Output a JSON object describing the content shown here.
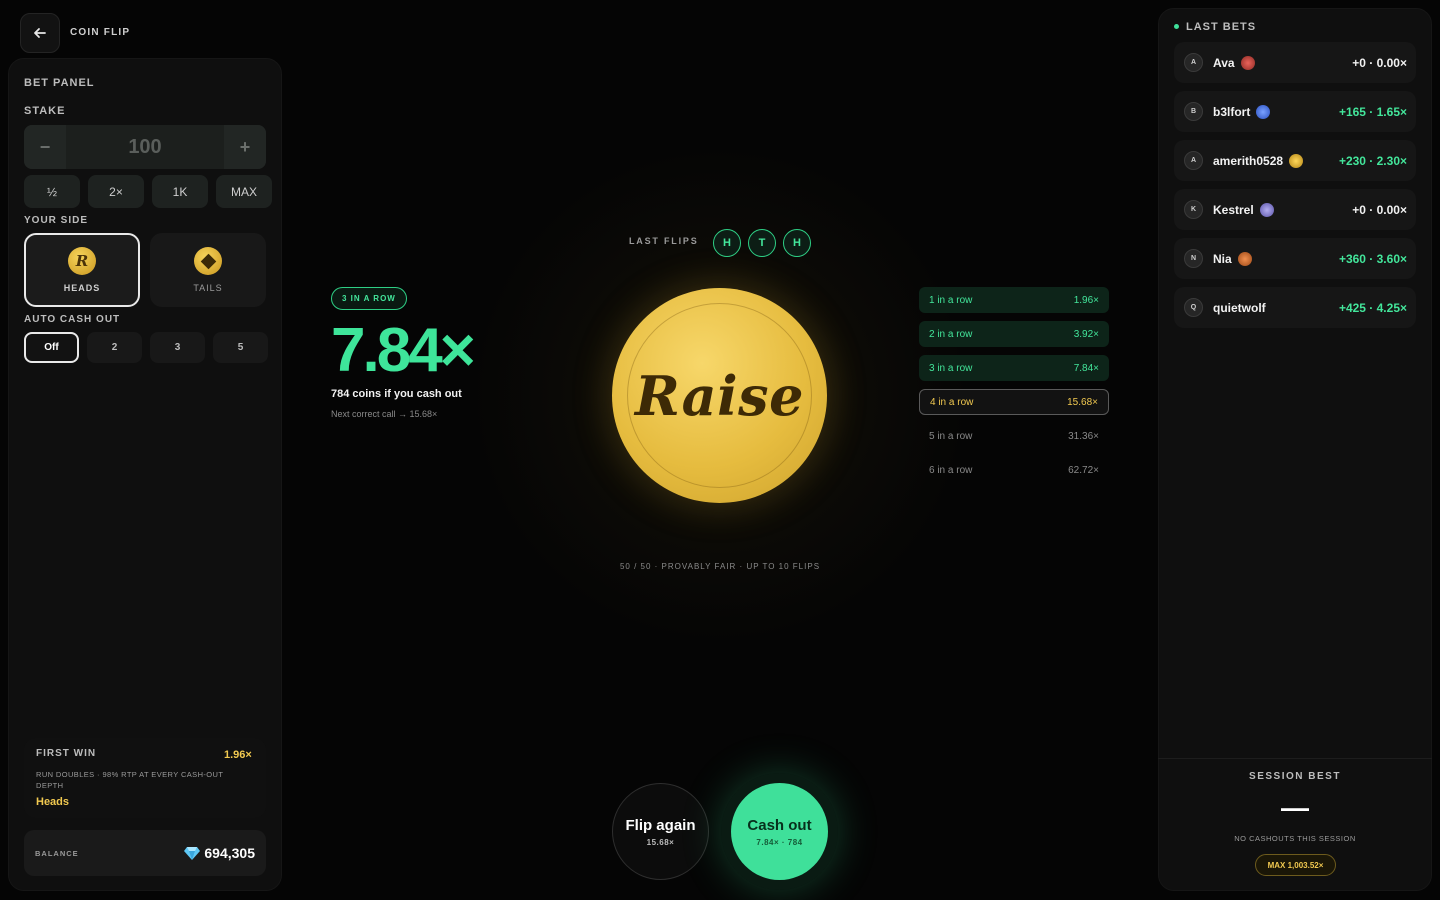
{
  "header": {
    "title": "COIN FLIP"
  },
  "bet_panel": {
    "title": "BET PANEL",
    "stake_label": "STAKE",
    "stake_value": "100",
    "minus": "−",
    "plus": "+",
    "chips": [
      "½",
      "2×",
      "1K",
      "MAX"
    ],
    "side_label": "YOUR SIDE",
    "sides": [
      {
        "name": "HEADS",
        "glyph": "R",
        "selected": true
      },
      {
        "name": "TAILS",
        "selected": false
      }
    ],
    "auto_label": "AUTO CASH OUT",
    "auto_options": [
      "Off",
      "2",
      "3",
      "5"
    ],
    "first_win": {
      "title": "FIRST WIN",
      "multiplier": "1.96×",
      "desc": "RUN DOUBLES · 98% RTP AT EVERY CASH-OUT DEPTH",
      "side": "Heads"
    },
    "balance": {
      "label": "BALANCE",
      "value": "694,305"
    }
  },
  "game": {
    "last_flips_label": "LAST FLIPS",
    "last_flips": [
      "H",
      "T",
      "H"
    ],
    "streak_badge": "3 IN A ROW",
    "multiplier": "7.84×",
    "cash_out_text": "784 coins if you cash out",
    "next_text": "Next correct call → 15.68×",
    "coin_text": "Raise",
    "ladder": [
      {
        "label": "1 in a row",
        "mult": "1.96×",
        "state": "done"
      },
      {
        "label": "2 in a row",
        "mult": "3.92×",
        "state": "done"
      },
      {
        "label": "3 in a row",
        "mult": "7.84×",
        "state": "done"
      },
      {
        "label": "4 in a row",
        "mult": "15.68×",
        "state": "cur"
      },
      {
        "label": "5 in a row",
        "mult": "31.36×",
        "state": "future"
      },
      {
        "label": "6 in a row",
        "mult": "62.72×",
        "state": "future"
      }
    ],
    "fair_text": "50 / 50 · PROVABLY FAIR · UP TO 10 FLIPS",
    "flip_button": {
      "label": "Flip again",
      "sub": "15.68×"
    },
    "cash_button": {
      "label": "Cash out",
      "sub": "7.84× · 784"
    }
  },
  "last_bets": {
    "title": "LAST BETS",
    "rows": [
      {
        "initial": "A",
        "name": "Ava",
        "badge": "#c2413a",
        "payout": "+0 · 0.00×",
        "win": false
      },
      {
        "initial": "B",
        "name": "b3lfort",
        "badge": "#3b6fe0",
        "payout": "+165 · 1.65×",
        "win": true
      },
      {
        "initial": "A",
        "name": "amerith0528",
        "badge": "#e0b22e",
        "payout": "+230 · 2.30×",
        "win": true
      },
      {
        "initial": "K",
        "name": "Kestrel",
        "badge": "#7b74c9",
        "payout": "+0 · 0.00×",
        "win": false
      },
      {
        "initial": "N",
        "name": "Nia",
        "badge": "#d06a2a",
        "payout": "+360 · 3.60×",
        "win": true
      },
      {
        "initial": "Q",
        "name": "quietwolf",
        "badge": "",
        "payout": "+425 · 4.25×",
        "win": true
      }
    ],
    "session": {
      "title": "SESSION BEST",
      "value": "—",
      "empty": "NO CASHOUTS THIS SESSION",
      "max": "MAX 1,003.52×"
    }
  },
  "colors": {
    "accent": "#3fe09a",
    "gold": "#f1c950",
    "bg": "#050505"
  }
}
